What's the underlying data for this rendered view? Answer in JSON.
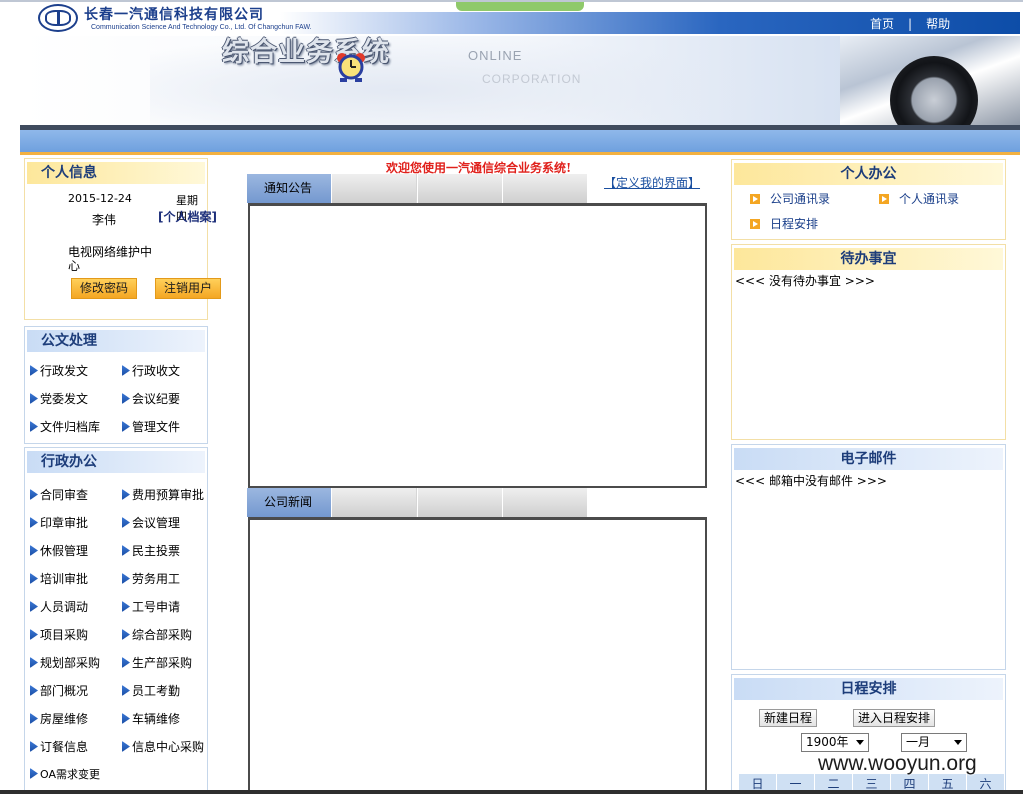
{
  "header": {
    "company_cn": "长春一汽通信科技有限公司",
    "company_en": "Communication Science And Technology Co., Ltd. Of Changchun FAW.",
    "nav": [
      "首页",
      "帮助"
    ],
    "nav_sep": "|",
    "banner_title": "综合业务系统",
    "banner_online": "ONLINE",
    "banner_corp": "CORPORATION"
  },
  "personal": {
    "title": "个人信息",
    "date": "2015-12-24",
    "weekday": "星期四",
    "name": "李伟",
    "archive_link": "[个人档案]",
    "org": "电视网络维护中心",
    "change_password": "修改密码",
    "logout": "注销用户"
  },
  "documents": {
    "title": "公文处理",
    "items": [
      "行政发文",
      "行政收文",
      "党委发文",
      "会议纪要",
      "文件归档库",
      "管理文件"
    ]
  },
  "admin": {
    "title": "行政办公",
    "items": [
      "合同审查",
      "费用预算审批",
      "印章审批",
      "会议管理",
      "休假管理",
      "民主投票",
      "培训审批",
      "劳务用工",
      "人员调动",
      "工号申请",
      "项目采购",
      "综合部采购",
      "规划部采购",
      "生产部采购",
      "部门概况",
      "员工考勤",
      "房屋维修",
      "车辆维修",
      "订餐信息",
      "信息中心采购",
      "OA需求变更"
    ]
  },
  "center": {
    "welcome": "欢迎您使用一汽通信综合业务系统!",
    "customize_link": "【定义我的界面】",
    "notice_tab": "通知公告",
    "news_tab": "公司新闻"
  },
  "office": {
    "title": "个人办公",
    "items": [
      "公司通讯录",
      "个人通讯录",
      "日程安排"
    ]
  },
  "todo": {
    "title": "待办事宜",
    "empty": "<<< 没有待办事宜 >>>"
  },
  "mail": {
    "title": "电子邮件",
    "empty": "<<< 邮箱中没有邮件 >>>"
  },
  "schedule": {
    "title": "日程安排",
    "new_btn": "新建日程",
    "enter_btn": "进入日程安排",
    "year_select": "1900年",
    "month_select": "一月",
    "weekdays": [
      "日",
      "一",
      "二",
      "三",
      "四",
      "五",
      "六"
    ]
  },
  "watermark": "www.wooyun.org",
  "colors": {
    "accent_blue": "#1c3f8c",
    "welcome_red": "#e0211c",
    "button_orange": "#f4a623"
  }
}
